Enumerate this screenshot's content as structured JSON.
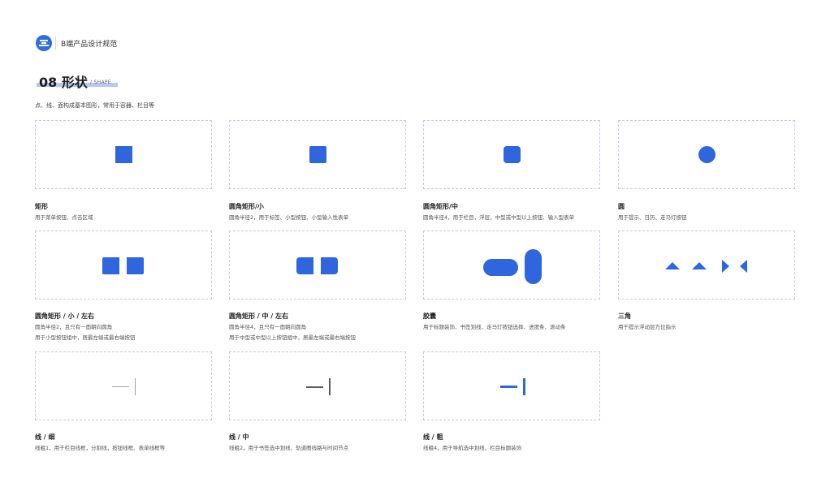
{
  "header": {
    "app_title": "B端产品设计规范",
    "logo_icon": "brand-logo-icon"
  },
  "section": {
    "title": "08 形状",
    "subtitle": "/ SHAPE",
    "intro": "点、线、面构成基本图形，常用于容器、栏目等"
  },
  "accent_color": "#2f66dd",
  "cards": [
    {
      "name": "矩形",
      "desc": [
        "用于菜单按钮、点击区域"
      ]
    },
    {
      "name": "圆角矩形/小",
      "desc": [
        "圆角半径2，用于标签、小型按钮、小型输入性表单"
      ]
    },
    {
      "name": "圆角矩形/中",
      "desc": [
        "圆角半径4，用于栏目，浮层，中型或中型以上按钮、输入型表单"
      ]
    },
    {
      "name": "圆",
      "desc": [
        "用于提示、日历、走马灯按钮"
      ]
    },
    {
      "name": "圆角矩形 / 小 / 左右",
      "desc": [
        "圆角半径2，且只有一面朝向圆角",
        "用于小型按钮组中，居最左端或最右端按钮"
      ]
    },
    {
      "name": "圆角矩形 / 中 / 左右",
      "desc": [
        "圆角半径4，且只有一面朝向圆角",
        "用于中型或中型以上按钮组中，居最左端或最右端按钮"
      ]
    },
    {
      "name": "胶囊",
      "desc": [
        "用于标题装饰、书签划线、走马灯按钮选择、进度条、滚动条"
      ]
    },
    {
      "name": "三角",
      "desc": [
        "用于提示浮动层方位指示"
      ]
    },
    {
      "name": "线 / 细",
      "desc": [
        "线粗1，用于栏目线框，分割线，按钮线框、表单线框等"
      ]
    },
    {
      "name": "线 / 中",
      "desc": [
        "线粗2，用于书签选中划线、轨道图线路与时间节点"
      ]
    },
    {
      "name": "线 / 粗",
      "desc": [
        "线粗4，用于导航选中划线、栏目标题装饰"
      ]
    }
  ]
}
